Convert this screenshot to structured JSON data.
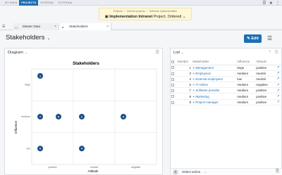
{
  "topnav": {
    "items": [
      "MY AREA",
      "PROJECTS",
      "INTERNAL",
      "EXTERNAL"
    ],
    "active_index": 1
  },
  "topicons": {
    "menu": "☰",
    "favorite": "★",
    "more": "⋮"
  },
  "breadcrumb": {
    "items": [
      "Projects",
      "Internal projects",
      "Software implementation"
    ],
    "project_name": "Implementation Intranet",
    "project_suffix": "Project, Ordered"
  },
  "tabs": [
    {
      "label": "Master Data",
      "icon": "folder-icon"
    },
    {
      "label": "Stakeholders",
      "icon": "stakeholders-icon"
    }
  ],
  "page": {
    "title": "Stakeholders",
    "edit_label": "Edit"
  },
  "diagram": {
    "view_label": "Diagram",
    "chart_title": "Stakeholders",
    "y_axis_label": "Influence",
    "x_axis_label": "Attitude"
  },
  "chart_data": {
    "type": "scatter",
    "title": "Stakeholders",
    "xlabel": "Attitude",
    "ylabel": "Influence",
    "x_categories": [
      "positive",
      "neutral",
      "negative"
    ],
    "y_categories": [
      "large",
      "medium",
      "low"
    ],
    "points": [
      {
        "label": "1",
        "x": "positive",
        "y": "large"
      },
      {
        "label": "7",
        "x": "positive",
        "y": "medium"
      },
      {
        "label": "9",
        "x": "positive",
        "y": "medium"
      },
      {
        "label": "2",
        "x": "neutral",
        "y": "medium"
      },
      {
        "label": "5",
        "x": "negative",
        "y": "medium"
      },
      {
        "label": "6",
        "x": "positive",
        "y": "low"
      },
      {
        "label": "4",
        "x": "neutral",
        "y": "low"
      }
    ],
    "point_color": "#1d4f86"
  },
  "list": {
    "view_label": "List",
    "columns": [
      "Number",
      "Stakeholder",
      "Influence",
      "Attitude"
    ],
    "rows": [
      {
        "number": "1",
        "name": "Management",
        "influence": "large",
        "attitude": "positive"
      },
      {
        "number": "3",
        "name": "Employees",
        "influence": "medium",
        "attitude": "neutral"
      },
      {
        "number": "4",
        "name": "External employees",
        "influence": "low",
        "attitude": "neutral"
      },
      {
        "number": "5",
        "name": "IT-Admin",
        "influence": "medium",
        "attitude": "negative"
      },
      {
        "number": "7",
        "name": "Software provider",
        "influence": "medium",
        "attitude": "positive"
      },
      {
        "number": "8",
        "name": "Marketing",
        "influence": "medium",
        "attitude": "positive"
      },
      {
        "number": "9",
        "name": "Project manager",
        "influence": "medium",
        "attitude": "positive"
      }
    ],
    "footer": {
      "selected_count": "0",
      "action_label": "Select action"
    }
  },
  "colors": {
    "accent": "#1f6fb3",
    "highlight": "#fff7d6"
  }
}
